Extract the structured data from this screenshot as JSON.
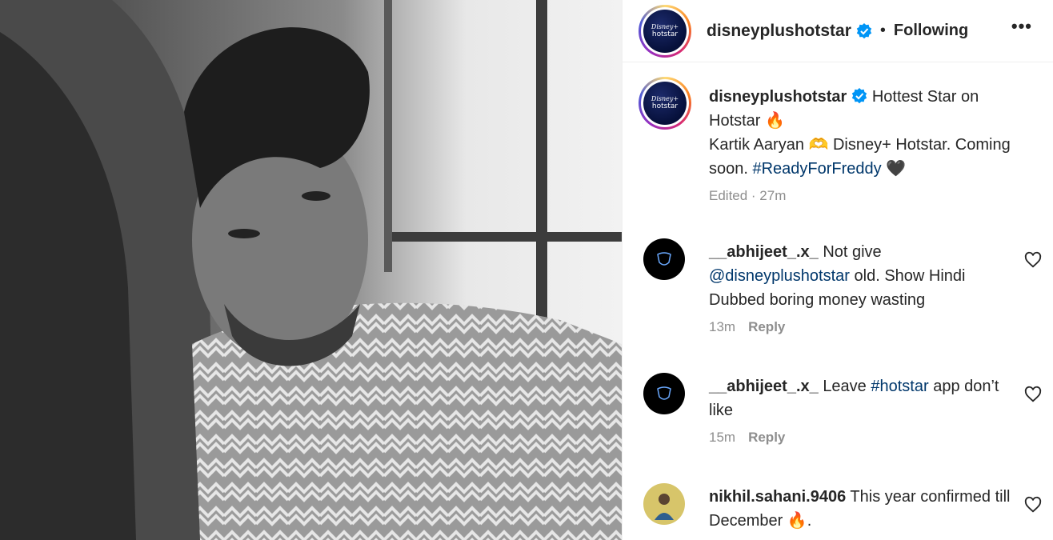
{
  "photo": {
    "subject": "black-and-white portrait photo"
  },
  "header": {
    "username": "disneyplushotstar",
    "avatar_text_1": "Disney+",
    "avatar_text_2": "hotstar",
    "separator": "•",
    "follow_status": "Following",
    "more": "•••"
  },
  "caption": {
    "username": "disneyplushotstar",
    "text_1": "Hottest Star on Hotstar 🔥",
    "text_2": "Kartik Aaryan 🫶 Disney+ Hotstar. Coming soon. ",
    "hashtag": "#ReadyForFreddy",
    "text_3": " 🖤",
    "meta": "Edited · 27m"
  },
  "comments": [
    {
      "username": "__abhijeet_.x_",
      "text_before": "Not give ",
      "mention": "@disneyplushotstar",
      "text_after": " old. Show Hindi Dubbed boring money wasting",
      "time": "13m",
      "reply": "Reply"
    },
    {
      "username": "__abhijeet_.x_",
      "text_before": "Leave ",
      "mention": "#hotstar",
      "text_after": " app don’t like",
      "time": "15m",
      "reply": "Reply"
    },
    {
      "username": "nikhil.sahani.9406",
      "text_before": "This year confirmed till December 🔥.",
      "mention": "",
      "text_after": ""
    }
  ],
  "colors": {
    "link": "#00376b",
    "verified": "#0095f6",
    "muted": "#8e8e8e"
  }
}
